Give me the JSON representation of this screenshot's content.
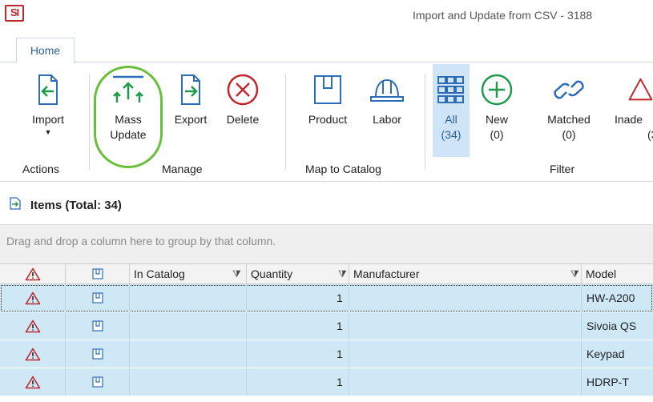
{
  "app": {
    "logo_text": "SI",
    "window_title": "Import and Update from CSV - 3188"
  },
  "tabs": [
    {
      "label": "Home"
    }
  ],
  "ribbon": {
    "actions": {
      "import_label": "Import",
      "group_label": "Actions"
    },
    "manage": {
      "mass_update_label": "Mass",
      "mass_update_label2": "Update",
      "export_label": "Export",
      "delete_label": "Delete",
      "group_label": "Manage"
    },
    "map": {
      "product_label": "Product",
      "labor_label": "Labor",
      "group_label": "Map to Catalog"
    },
    "filter": {
      "all_label": "All",
      "all_count": "(34)",
      "new_label": "New",
      "new_count": "(0)",
      "matched_label": "Matched",
      "matched_count": "(0)",
      "inadequate_label": "Inade",
      "inadequate_count": "(3",
      "group_label": "Filter"
    }
  },
  "items": {
    "title": "Items (Total: 34)"
  },
  "group_panel": {
    "hint": "Drag and drop a column here to group by that column."
  },
  "grid": {
    "columns": [
      "In Catalog",
      "Quantity",
      "Manufacturer",
      "Model"
    ],
    "rows": [
      {
        "quantity": "1",
        "manufacturer": "",
        "model": "HW-A200"
      },
      {
        "quantity": "1",
        "manufacturer": "",
        "model": "Sivoia QS"
      },
      {
        "quantity": "1",
        "manufacturer": "",
        "model": "Keypad"
      },
      {
        "quantity": "1",
        "manufacturer": "",
        "model": "HDRP-T"
      }
    ]
  },
  "colors": {
    "accent": "#2d6db5",
    "warning": "#c0272d",
    "selection": "#cfe8f6",
    "highlight": "#6abf3a",
    "icon_green": "#1f9a4b"
  }
}
